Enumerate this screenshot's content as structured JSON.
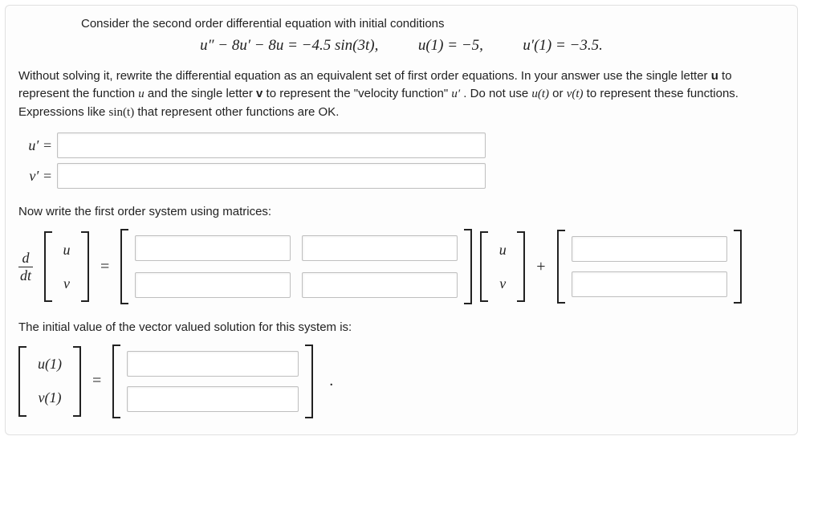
{
  "intro": "Consider the second order differential equation with initial conditions",
  "equation": {
    "ode": "u″ − 8u′ − 8u = −4.5 sin(3t),",
    "ic1": "u(1) = −5,",
    "ic2": "u′(1) = −3.5."
  },
  "instructions_parts": {
    "p1": "Without solving it, rewrite the differential equation as an equivalent set of first order equations. In your answer use the single letter ",
    "u_bold": "u",
    "p2": " to represent the function ",
    "u_math": "u",
    "p3": " and the single letter ",
    "v_bold": "v",
    "p4": " to represent the \"velocity function\" ",
    "uprime": "u′",
    "p5": " . Do not use ",
    "ut": "u(t)",
    "p6": " or ",
    "vt": "v(t)",
    "p7": " to represent these functions. Expressions like ",
    "sint": "sin(t)",
    "p8": " that represent other functions are OK."
  },
  "labels": {
    "uprime_eq": "u′ =",
    "vprime_eq": "v′ =",
    "d": "d",
    "dt": "dt",
    "u": "u",
    "v": "v",
    "eq": "=",
    "plus": "+",
    "u1": "u(1)",
    "v1": "v(1)",
    "dot": "."
  },
  "section2": "Now write the first order system using matrices:",
  "section3": "The initial value of the vector valued solution for this system is:",
  "inputs": {
    "uprime": "",
    "vprime": "",
    "A11": "",
    "A12": "",
    "A21": "",
    "A22": "",
    "f1": "",
    "f2": "",
    "ic_u": "",
    "ic_v": ""
  }
}
